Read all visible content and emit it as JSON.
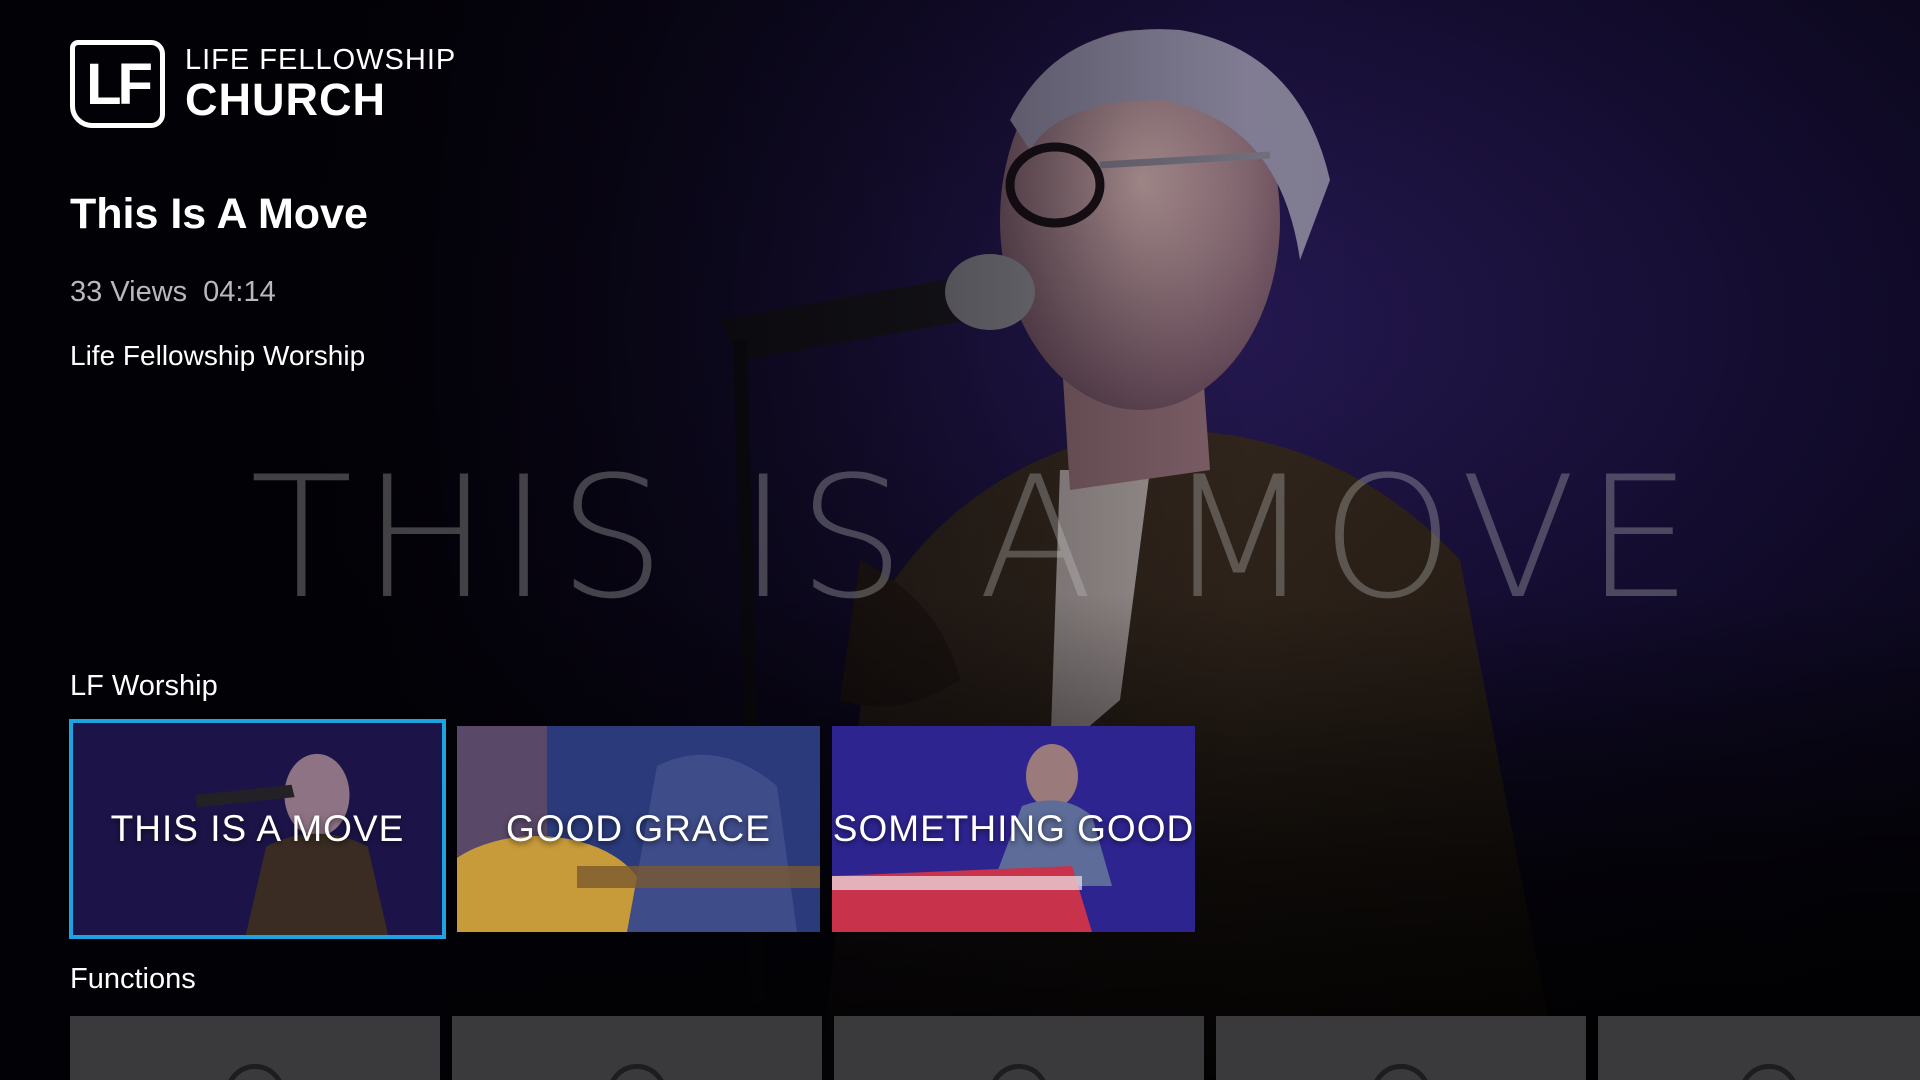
{
  "logo": {
    "mark": "LF",
    "line1": "LIFE FELLOWSHIP",
    "line2": "CHURCH"
  },
  "hero": {
    "overlay_text": "THIS IS A MOVE"
  },
  "video": {
    "title": "This Is A Move",
    "views": "33 Views",
    "duration": "04:14",
    "channel": "Life Fellowship Worship"
  },
  "rows": {
    "worship": {
      "label": "LF Worship",
      "cards": [
        {
          "label": "THIS IS A MOVE",
          "focused": true
        },
        {
          "label": "GOOD GRACE",
          "focused": false
        },
        {
          "label": "SOMETHING GOOD",
          "focused": false
        }
      ]
    },
    "functions": {
      "label": "Functions",
      "items": [
        "",
        "",
        "",
        "",
        ""
      ]
    }
  },
  "colors": {
    "focus": "#1fa3e0",
    "background": "#050308",
    "meta_text": "#b9b9bd"
  }
}
